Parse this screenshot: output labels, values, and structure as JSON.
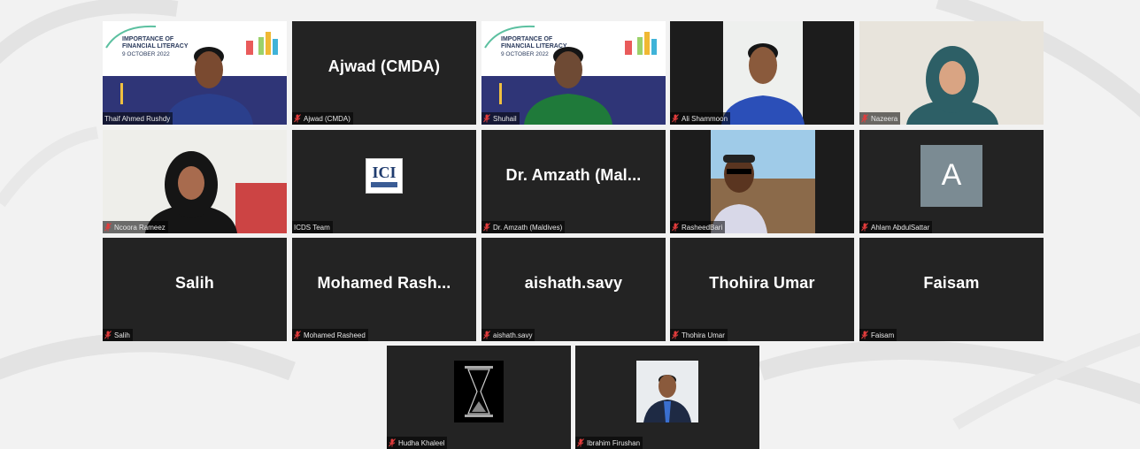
{
  "participants": [
    {
      "label": "Thaif Ahmed Rushdy",
      "display": "",
      "muted": false,
      "kind": "video-banner"
    },
    {
      "label": "Ajwad (CMDA)",
      "display": "Ajwad (CMDA)",
      "muted": true,
      "kind": "name"
    },
    {
      "label": "Shuhail",
      "display": "",
      "muted": true,
      "kind": "video-banner"
    },
    {
      "label": "Ali Shammoon",
      "display": "",
      "muted": true,
      "kind": "video-plain"
    },
    {
      "label": "Nazeera",
      "display": "",
      "muted": true,
      "kind": "video-hijab"
    },
    {
      "label": "Ncoora Rameez",
      "display": "",
      "muted": true,
      "kind": "video-office"
    },
    {
      "label": "ICDS Team",
      "display": "",
      "muted": false,
      "kind": "logo"
    },
    {
      "label": "Dr. Amzath (Maldives)",
      "display": "Dr. Amzath (Mal...",
      "muted": true,
      "kind": "name"
    },
    {
      "label": "RasheedBari",
      "display": "",
      "muted": true,
      "kind": "video-outdoor"
    },
    {
      "label": "Ahlam AbdulSattar",
      "display": "A",
      "muted": true,
      "kind": "avatar"
    },
    {
      "label": "Salih",
      "display": "Salih",
      "muted": true,
      "kind": "name"
    },
    {
      "label": "Mohamed Rasheed",
      "display": "Mohamed  Rash...",
      "muted": true,
      "kind": "name"
    },
    {
      "label": "aishath.savy",
      "display": "aishath.savy",
      "muted": true,
      "kind": "name"
    },
    {
      "label": "Thohira Umar",
      "display": "Thohira Umar",
      "muted": true,
      "kind": "name"
    },
    {
      "label": "Faisam",
      "display": "Faisam",
      "muted": true,
      "kind": "name"
    },
    {
      "label": "Hudha Khaleel",
      "display": "",
      "muted": true,
      "kind": "photo-hourglass"
    },
    {
      "label": "Ibrahim Firushan",
      "display": "",
      "muted": true,
      "kind": "photo-portrait"
    }
  ],
  "banner": {
    "line1": "IMPORTANCE OF",
    "line2": "FINANCIAL LITERACY",
    "date": "9 OCTOBER 2022"
  },
  "logo": {
    "text": "ICI"
  },
  "colors": {
    "tile": "#232323",
    "background": "#f2f2f2",
    "muted_mic": "#e23c3c"
  }
}
